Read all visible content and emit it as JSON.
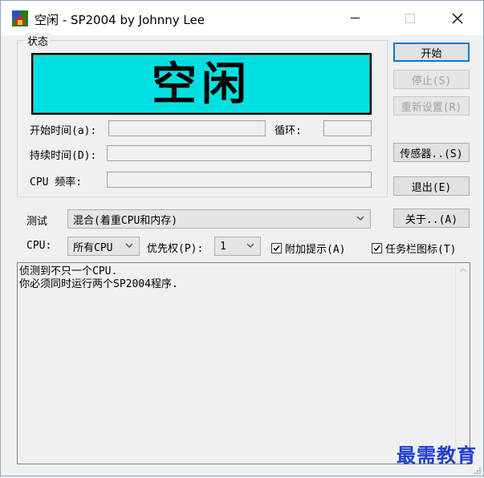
{
  "window": {
    "title": "空闲 - SP2004 by Johnny Lee",
    "minimize_label": "—",
    "maximize_label": "☐",
    "close_label": "✕"
  },
  "status": {
    "group_title": "状态",
    "display_text": "空闲",
    "display_bg": "#00e0e0",
    "start_time_label": "开始时间(a):",
    "start_time_value": "",
    "loop_label": "循环:",
    "loop_value": "",
    "duration_label": "持续时间(D):",
    "duration_value": "",
    "cpu_freq_label": "CPU 频率:",
    "cpu_freq_value": ""
  },
  "buttons": {
    "start": "开始",
    "stop": "停止(S)",
    "reset": "重新设置(R)",
    "sensor": "传感器..(S)",
    "exit": "退出(E)",
    "about": "关于..(A)"
  },
  "test": {
    "label": "测试",
    "selected": "混合(着重CPU和内存)"
  },
  "cpu": {
    "label": "CPU:",
    "selected": "所有CPU"
  },
  "priority": {
    "label": "优先权(P):",
    "selected": "1"
  },
  "options": {
    "extra_hint_label": "附加提示(A)",
    "extra_hint_checked": true,
    "tray_icon_label": "任务栏图标(T)",
    "tray_icon_checked": true
  },
  "log": {
    "text": "侦测到不只一个CPU.\n你必须同时运行两个SP2004程序."
  },
  "watermark": {
    "text": "最需教育",
    "color": "#1f3fd0"
  }
}
